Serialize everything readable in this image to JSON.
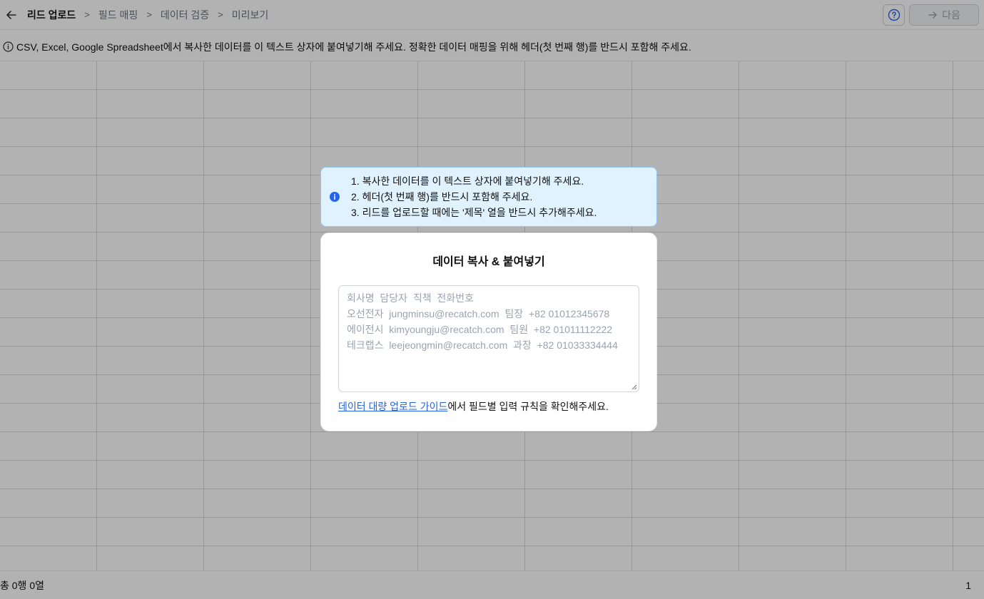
{
  "header": {
    "breadcrumbs": [
      "리드 업로드",
      "필드 매핑",
      "데이터 검증",
      "미리보기"
    ],
    "separator": ">",
    "next_label": "다음"
  },
  "infobar": {
    "text": "CSV, Excel, Google Spreadsheet에서 복사한 데이터를 이 텍스트 상자에 붙여넣기해 주세요. 정확한 데이터 매핑을 위해 헤더(첫 번째 행)를 반드시 포함해 주세요."
  },
  "notice": {
    "items": [
      "1. 복사한 데이터를 이 텍스트 상자에 붙여넣기해 주세요.",
      "2. 헤더(첫 번째 행)를 반드시 포함해 주세요.",
      "3. 리드를 업로드할 때에는 '제목' 열을 반드시 추가해주세요."
    ]
  },
  "modal": {
    "title": "데이터 복사 & 붙여넣기",
    "placeholder_lines": [
      "회사명  담당자  직책  전화번호",
      "오선전자  jungminsu@recatch.com  팀장  +82 01012345678",
      "에이전시  kimyoungju@recatch.com  팀원  +82 01011112222",
      "테크랩스  leejeongmin@recatch.com  과장  +82 01033334444"
    ],
    "guide_link": "데이터 대량 업로드 가이드",
    "guide_rest": "에서 필드별 입력 규칙을 확인해주세요."
  },
  "footer": {
    "count": "총 0행 0열",
    "page": "1"
  },
  "colors": {
    "accent": "#2563eb",
    "notice_bg": "#e0f2fe",
    "notice_border": "#93c5fd"
  }
}
